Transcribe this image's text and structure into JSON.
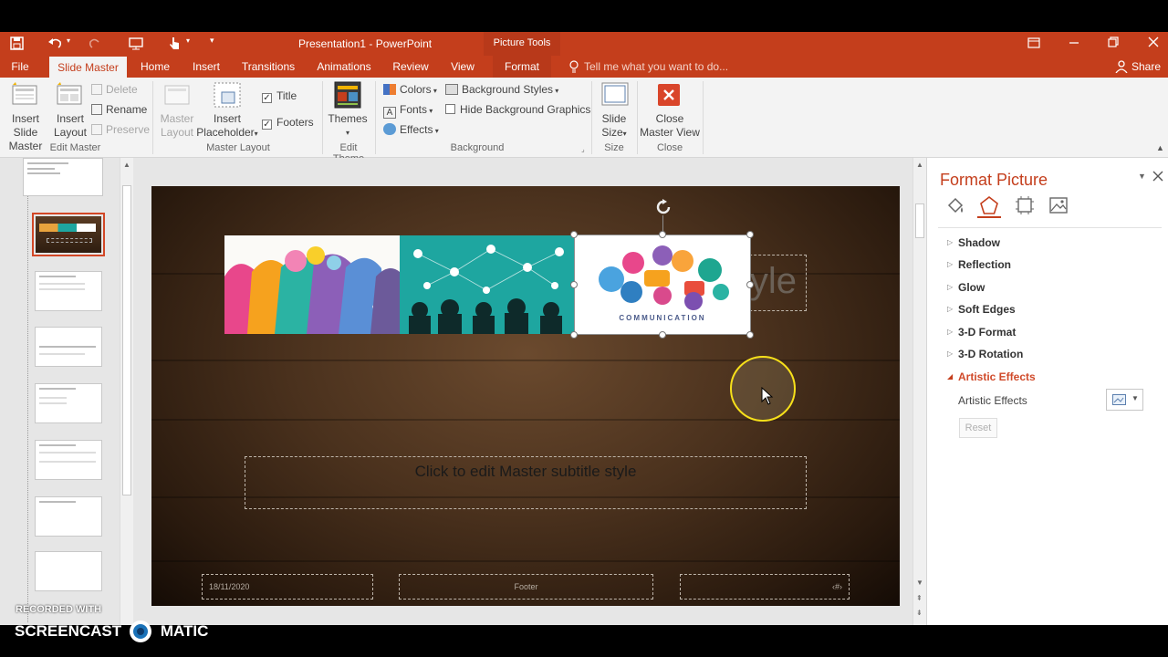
{
  "window": {
    "title": "Presentation1 - PowerPoint",
    "context_tool": "Picture Tools"
  },
  "tabs": [
    {
      "label": "File"
    },
    {
      "label": "Slide Master"
    },
    {
      "label": "Home"
    },
    {
      "label": "Insert"
    },
    {
      "label": "Transitions"
    },
    {
      "label": "Animations"
    },
    {
      "label": "Review"
    },
    {
      "label": "View"
    },
    {
      "label": "Format"
    }
  ],
  "tell_me": "Tell me what you want to do...",
  "share": "Share",
  "ribbon": {
    "insert_slide_master": [
      "Insert Slide",
      "Master"
    ],
    "insert_layout": [
      "Insert",
      "Layout"
    ],
    "delete": "Delete",
    "rename": "Rename",
    "preserve": "Preserve",
    "group_edit_master": "Edit Master",
    "master_layout": [
      "Master",
      "Layout"
    ],
    "insert_placeholder": [
      "Insert",
      "Placeholder"
    ],
    "title_cb": "Title",
    "footers_cb": "Footers",
    "group_master_layout": "Master Layout",
    "themes": "Themes",
    "group_edit_theme": "Edit Theme",
    "colors": "Colors",
    "fonts": "Fonts",
    "effects": "Effects",
    "background_styles": "Background Styles",
    "hide_bg": "Hide Background Graphics",
    "group_background": "Background",
    "slide_size": [
      "Slide",
      "Size"
    ],
    "group_size": "Size",
    "close_master": [
      "Close",
      "Master View"
    ],
    "group_close": "Close"
  },
  "slide": {
    "title_partial": "yle",
    "subtitle": "Click to edit Master subtitle style",
    "date": "18/11/2020",
    "footer": "Footer",
    "page_number": "‹#›",
    "image3_caption": "COMMUNICATION"
  },
  "format_pane": {
    "title": "Format Picture",
    "sections": [
      {
        "label": "Shadow",
        "expanded": false
      },
      {
        "label": "Reflection",
        "expanded": false
      },
      {
        "label": "Glow",
        "expanded": false
      },
      {
        "label": "Soft Edges",
        "expanded": false
      },
      {
        "label": "3-D Format",
        "expanded": false
      },
      {
        "label": "3-D Rotation",
        "expanded": false
      },
      {
        "label": "Artistic Effects",
        "expanded": true
      }
    ],
    "artistic_effects_label": "Artistic Effects",
    "reset": "Reset"
  },
  "watermark": {
    "line1": "RECORDED WITH",
    "line2_left": "SCREENCAST",
    "line2_right": "MATIC"
  },
  "colors": {
    "accent": "#c43e1c",
    "pane_title": "#c43e1c",
    "active_section": "#d04a2a"
  }
}
